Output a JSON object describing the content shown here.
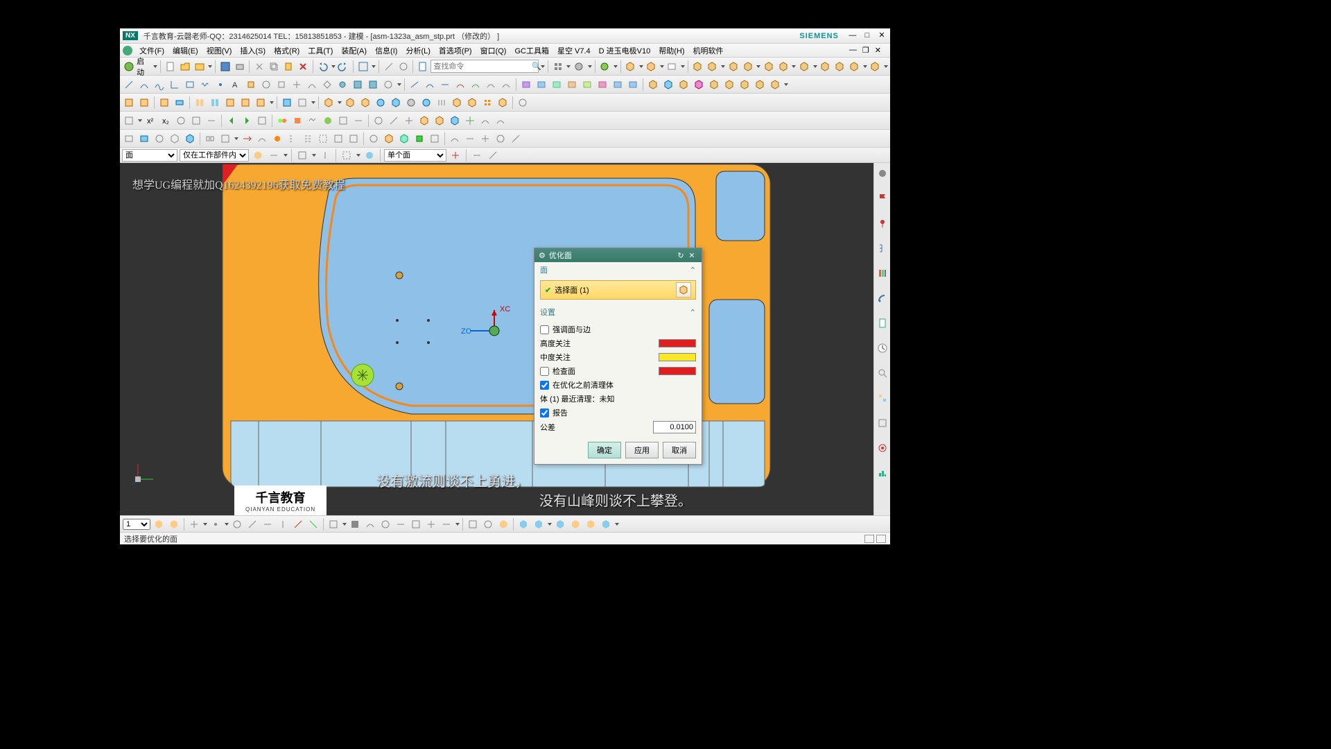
{
  "title": "千言教育-云磬老师-QQ：2314625014 TEL：15813851853 - 建模 - [asm-1323a_asm_stp.prt （修改的） ]",
  "brand": "SIEMENS",
  "logo": "NX",
  "menu": {
    "file": "文件(F)",
    "edit": "编辑(E)",
    "view": "视图(V)",
    "insert": "插入(S)",
    "format": "格式(R)",
    "tool": "工具(T)",
    "assembly": "装配(A)",
    "info": "信息(I)",
    "analyze": "分析(L)",
    "pref": "首选项(P)",
    "window": "窗口(Q)",
    "gc": "GC工具箱",
    "xk": "星空 V7.4",
    "jy": "D 进玉电极V10",
    "help": "帮助(H)",
    "soft": "机明软件"
  },
  "toolbar1": {
    "start": "启动",
    "search_ph": "查找命令"
  },
  "filter": {
    "sel1": "面",
    "sel2": "仅在工作部件内",
    "sel3": "单个面"
  },
  "overlay": "想学UG编程就加Q1624392196获取免费教程",
  "axis": {
    "x": "XC",
    "z": "ZC"
  },
  "watermark": {
    "main": "千言教育",
    "sub": "QIANYAN EDUCATION"
  },
  "sub1": "没有激流则谈不上勇进，",
  "sub2": "没有山峰则谈不上攀登。",
  "dialog": {
    "title": "优化面",
    "sec_face": "面",
    "select": "选择面 (1)",
    "sec_set": "设置",
    "emph": "强调面与边",
    "hi": "高度关注",
    "mid": "中度关注",
    "chkface": "检查面",
    "clean": "在优化之前清理体",
    "body": "体 (1) 最近清理：未知",
    "report": "报告",
    "tol": "公差",
    "tol_val": "0.0100",
    "ok": "确定",
    "apply": "应用",
    "cancel": "取消"
  },
  "btm": {
    "num": "1"
  },
  "status": "选择要优化的面"
}
